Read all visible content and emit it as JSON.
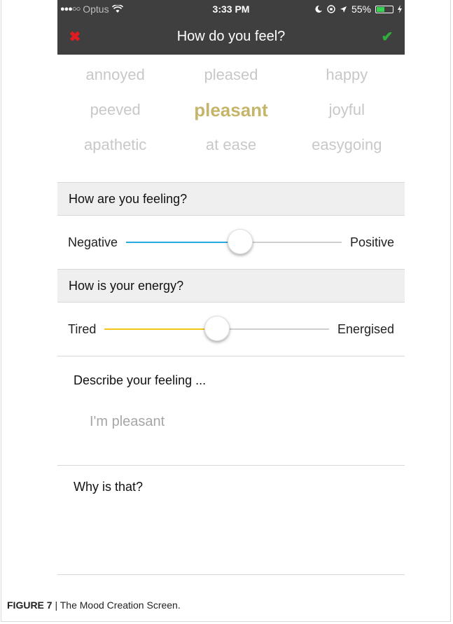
{
  "status_bar": {
    "signal_dots": "●●●○○",
    "carrier": "Optus",
    "time": "3:33 PM",
    "battery_text": "55%",
    "battery_level": 0.55
  },
  "nav": {
    "title": "How do you feel?",
    "cancel_icon": "x-icon",
    "confirm_icon": "checkmark-icon",
    "cancel_glyph": "✖",
    "confirm_glyph": "✔"
  },
  "moods": [
    [
      "annoyed",
      "pleased",
      "happy"
    ],
    [
      "peeved",
      "pleasant",
      "joyful"
    ],
    [
      "apathetic",
      "at ease",
      "easygoing"
    ]
  ],
  "selected_mood": "pleasant",
  "colors": {
    "bar": "#3f3f3f",
    "selected_word": "#c5b56a",
    "valence_fill": "#2aa9e0",
    "energy_fill": "#f2c418",
    "cancel": "#e11b22",
    "confirm": "#2fae3a"
  },
  "feeling_section": {
    "header": "How are you feeling?",
    "left_label": "Negative",
    "right_label": "Positive",
    "value": 0.53
  },
  "energy_section": {
    "header": "How is your energy?",
    "left_label": "Tired",
    "right_label": "Energised",
    "value": 0.5
  },
  "describe": {
    "label": "Describe your feeling ...",
    "value": "I'm pleasant"
  },
  "why": {
    "label": "Why is that?"
  },
  "caption": {
    "figure": "FIGURE 7",
    "separator": " | ",
    "text": "The Mood Creation Screen."
  }
}
